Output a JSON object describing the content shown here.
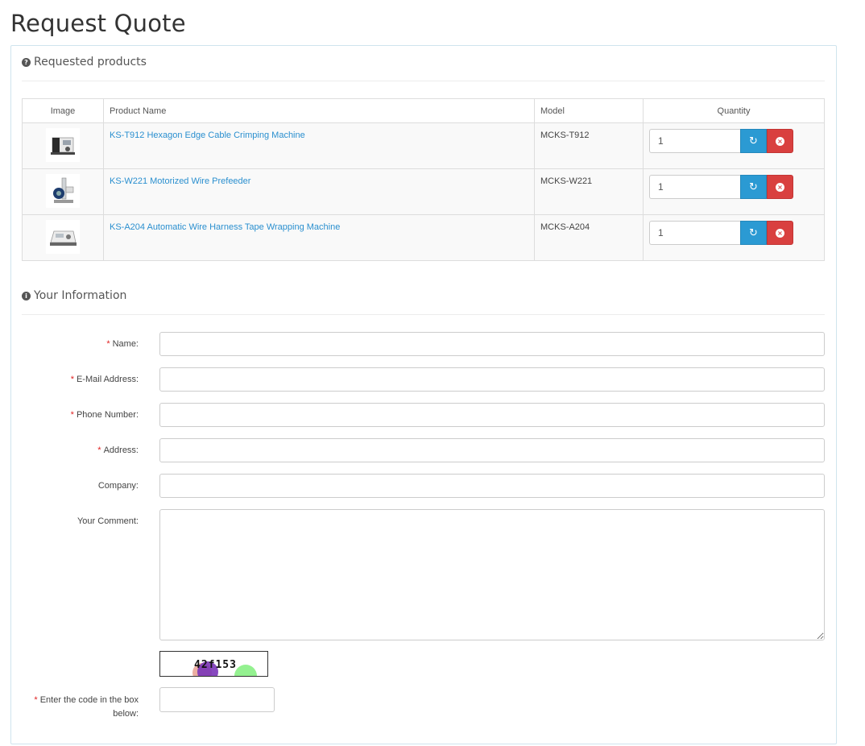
{
  "page": {
    "title": "Request Quote"
  },
  "products_section": {
    "heading": "Requested products",
    "columns": {
      "image": "Image",
      "name": "Product Name",
      "model": "Model",
      "quantity": "Quantity"
    },
    "rows": [
      {
        "name": "KS-T912 Hexagon Edge Cable Crimping Machine",
        "model": "MCKS-T912",
        "quantity": "1"
      },
      {
        "name": "KS-W221 Motorized Wire Prefeeder",
        "model": "MCKS-W221",
        "quantity": "1"
      },
      {
        "name": "KS-A204 Automatic Wire Harness Tape Wrapping Machine",
        "model": "MCKS-A204",
        "quantity": "1"
      }
    ],
    "icons": {
      "refresh": "refresh-icon",
      "remove": "remove-icon"
    }
  },
  "info_section": {
    "heading": "Your Information",
    "fields": {
      "name": {
        "label": "Name:",
        "required": "*"
      },
      "email": {
        "label": "E-Mail Address:",
        "required": "*"
      },
      "phone": {
        "label": "Phone Number:",
        "required": "*"
      },
      "address": {
        "label": "Address:",
        "required": "*"
      },
      "company": {
        "label": "Company:"
      },
      "comment": {
        "label": "Your Comment:"
      },
      "captcha": {
        "label_line1": "Enter the code in the box",
        "label_line2": "below:",
        "required": "*"
      }
    },
    "captcha_code": "42f153"
  },
  "colors": {
    "link": "#2a8fcf",
    "refresh_button": "#2b9ad3",
    "remove_button": "#d9403f",
    "required_mark": "#e02222"
  }
}
